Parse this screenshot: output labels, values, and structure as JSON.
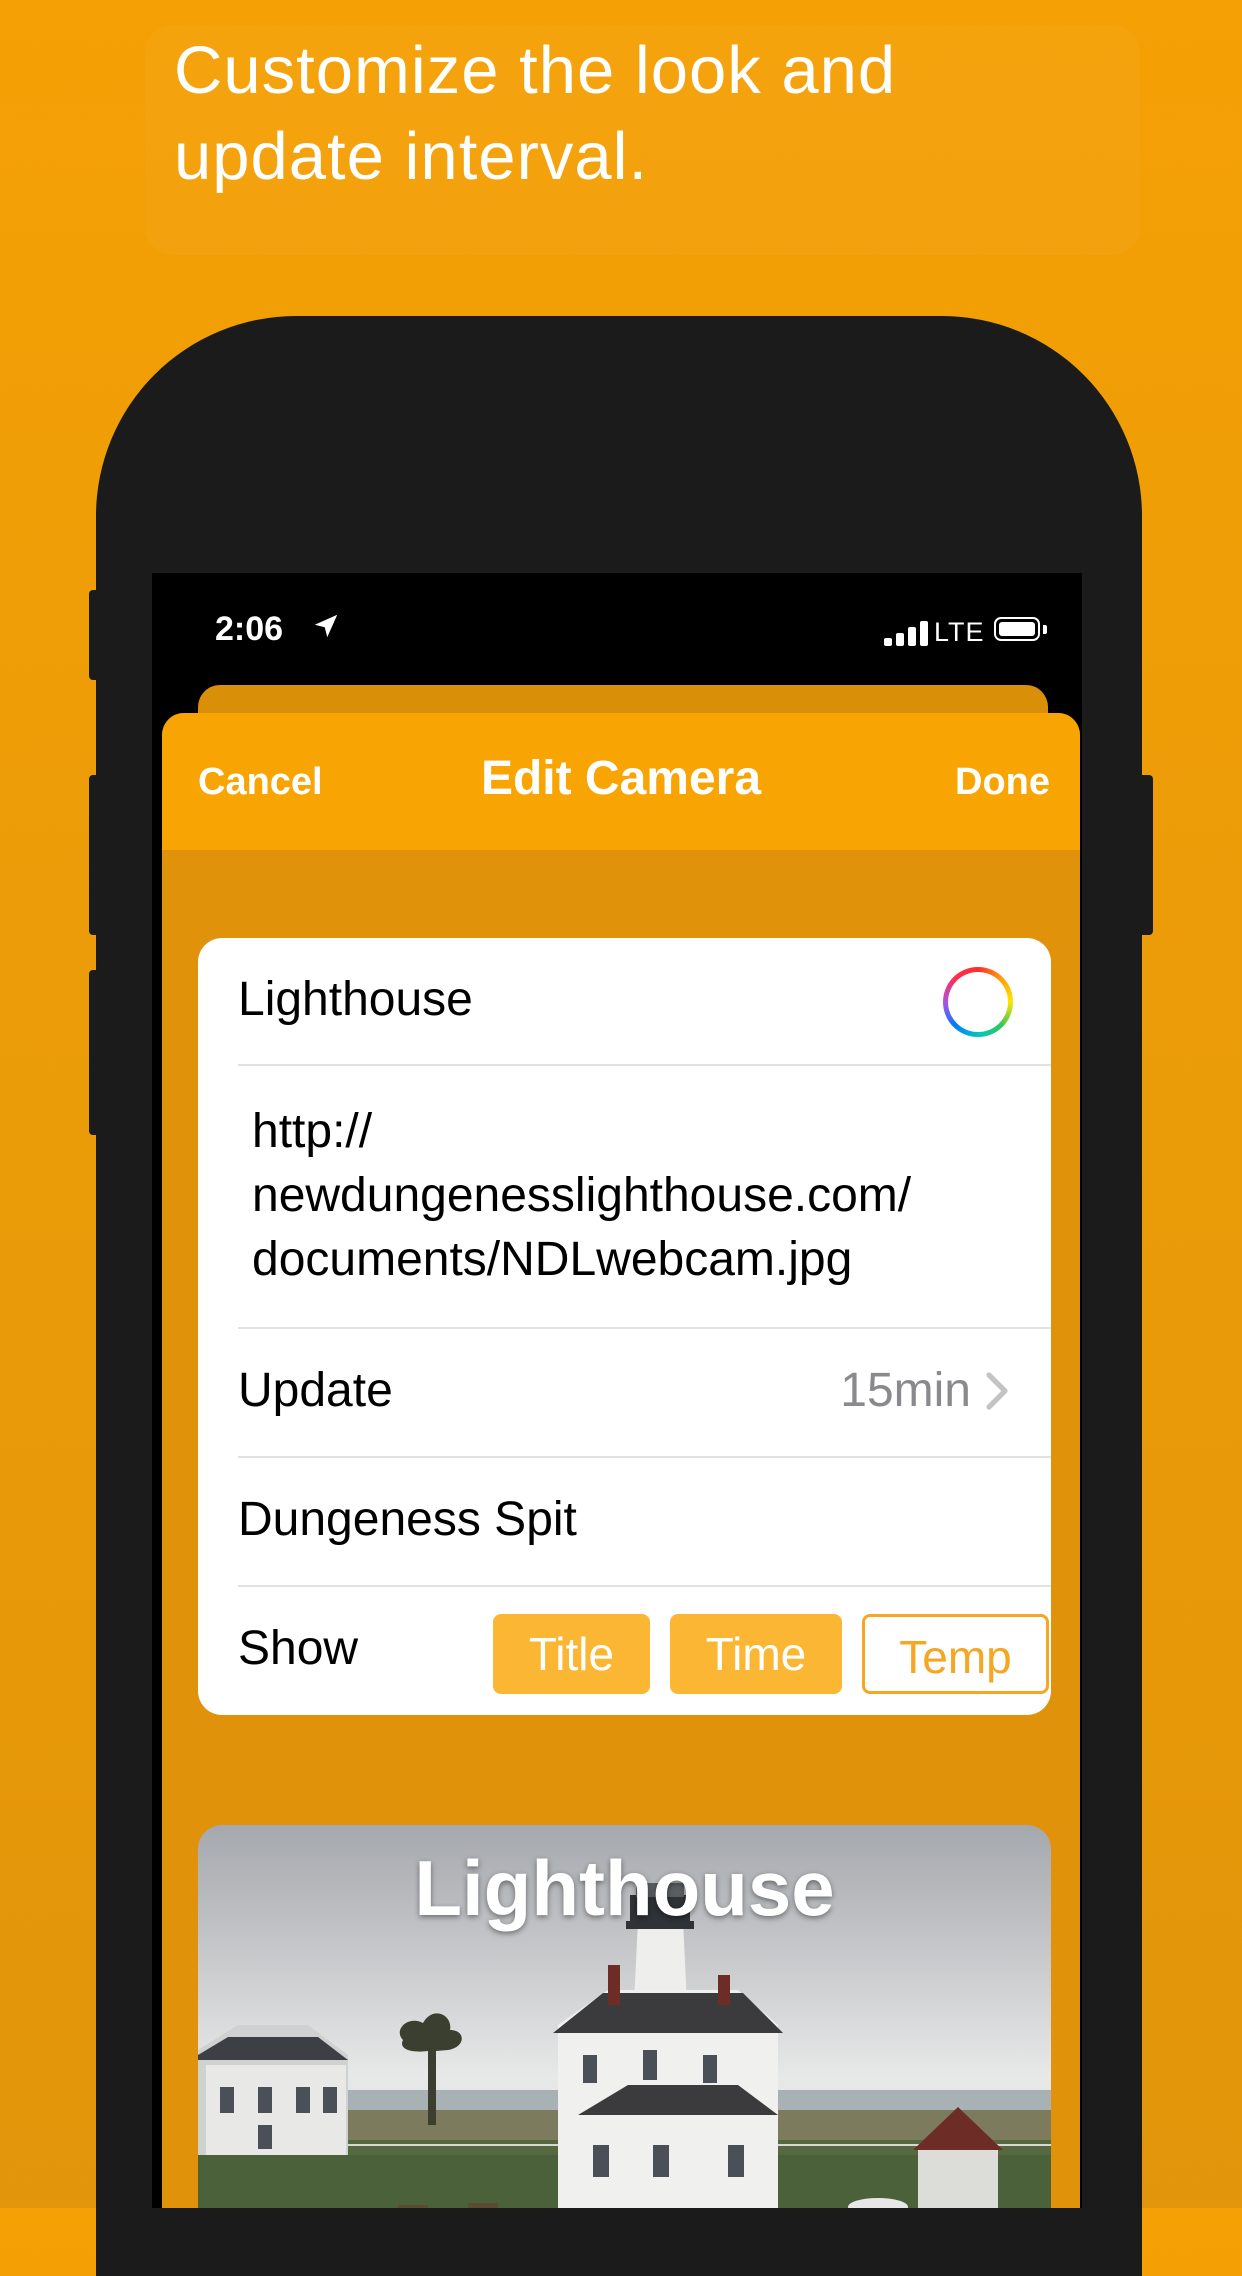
{
  "headline": "Customize the look and\nupdate interval.",
  "colors": {
    "background": "#f5a005",
    "nav_bar": "#f8a403",
    "accent": "#f5a623",
    "segment_on": "#fbb733"
  },
  "status_bar": {
    "time": "2:06",
    "network": "LTE",
    "icons": [
      "location-arrow-icon",
      "cellular-signal-icon",
      "battery-icon"
    ]
  },
  "nav": {
    "cancel": "Cancel",
    "title": "Edit Camera",
    "done": "Done"
  },
  "form": {
    "name": "Lighthouse",
    "url": "http://\nnewdungenesslighthouse.com/\ndocuments/NDLwebcam.jpg",
    "update_label": "Update",
    "update_value": "15min",
    "subtitle": "Dungeness Spit",
    "show_label": "Show",
    "show_options": [
      {
        "label": "Title",
        "selected": true
      },
      {
        "label": "Time",
        "selected": true
      },
      {
        "label": "Temp",
        "selected": false
      }
    ]
  },
  "preview": {
    "title": "Lighthouse"
  }
}
